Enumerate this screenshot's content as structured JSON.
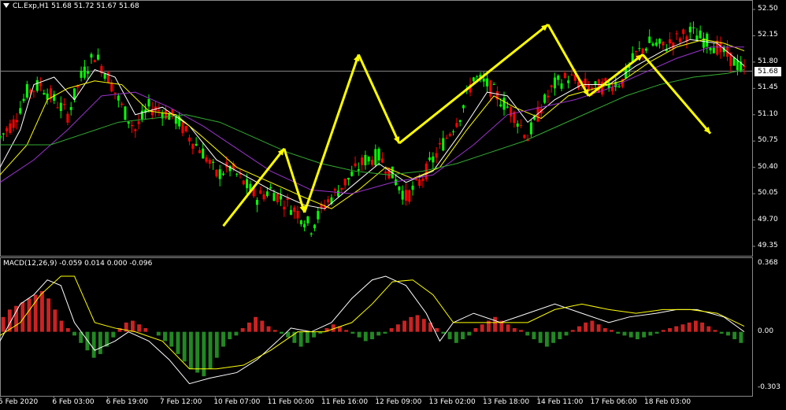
{
  "header": {
    "symbol_line": "CL.Exp,H1  51.68 51.72 51.67 51.68",
    "macd_line": "MACD(12,26,9) -0.059 0.014 0.000 -0.096",
    "current_price": "51.68"
  },
  "chart_data": [
    {
      "type": "candlestick",
      "title": "CL.Exp,H1",
      "ylim": [
        49.35,
        52.5
      ],
      "ytick_labels": [
        "52.50",
        "52.15",
        "51.80",
        "51.45",
        "51.10",
        "50.75",
        "50.40",
        "50.05",
        "49.70",
        "49.35"
      ],
      "xtick_labels": [
        "5 Feb 2020",
        "6 Feb 03:00",
        "6 Feb 19:00",
        "7 Feb 12:00",
        "10 Feb 07:00",
        "11 Feb 00:00",
        "11 Feb 16:00",
        "12 Feb 09:00",
        "13 Feb 02:00",
        "13 Feb 18:00",
        "14 Feb 11:00",
        "17 Feb 06:00",
        "18 Feb 03:00"
      ],
      "current_price": 51.68,
      "price_path": [
        [
          0,
          50.8
        ],
        [
          4,
          51.0
        ],
        [
          8,
          51.4
        ],
        [
          12,
          51.5
        ],
        [
          16,
          51.3
        ],
        [
          20,
          51.1
        ],
        [
          24,
          51.6
        ],
        [
          28,
          51.9
        ],
        [
          32,
          51.6
        ],
        [
          36,
          51.2
        ],
        [
          40,
          50.9
        ],
        [
          44,
          51.2
        ],
        [
          48,
          51.15
        ],
        [
          52,
          51.05
        ],
        [
          56,
          50.8
        ],
        [
          60,
          50.6
        ],
        [
          64,
          50.3
        ],
        [
          68,
          50.4
        ],
        [
          72,
          50.2
        ],
        [
          76,
          50.0
        ],
        [
          80,
          50.1
        ],
        [
          84,
          49.95
        ],
        [
          88,
          49.8
        ],
        [
          92,
          49.6
        ],
        [
          96,
          49.9
        ],
        [
          100,
          50.1
        ],
        [
          104,
          50.3
        ],
        [
          108,
          50.5
        ],
        [
          112,
          50.55
        ],
        [
          116,
          50.3
        ],
        [
          120,
          50.0
        ],
        [
          124,
          50.2
        ],
        [
          128,
          50.5
        ],
        [
          132,
          50.8
        ],
        [
          136,
          51.1
        ],
        [
          140,
          51.6
        ],
        [
          144,
          51.5
        ],
        [
          148,
          51.3
        ],
        [
          152,
          51.1
        ],
        [
          156,
          50.8
        ],
        [
          160,
          51.2
        ],
        [
          164,
          51.5
        ],
        [
          168,
          51.6
        ],
        [
          172,
          51.5
        ],
        [
          176,
          51.45
        ],
        [
          180,
          51.5
        ],
        [
          184,
          51.55
        ],
        [
          188,
          51.9
        ],
        [
          192,
          52.05
        ],
        [
          196,
          52.0
        ],
        [
          200,
          52.1
        ],
        [
          204,
          52.2
        ],
        [
          208,
          52.1
        ],
        [
          212,
          52.0
        ],
        [
          216,
          51.85
        ],
        [
          220,
          51.68
        ]
      ],
      "moving_averages": [
        {
          "color": "#ffffff",
          "points": [
            [
              0,
              50.4
            ],
            [
              6,
              50.9
            ],
            [
              10,
              51.5
            ],
            [
              16,
              51.6
            ],
            [
              22,
              51.3
            ],
            [
              28,
              51.7
            ],
            [
              34,
              51.6
            ],
            [
              40,
              51.1
            ],
            [
              48,
              51.2
            ],
            [
              56,
              50.95
            ],
            [
              64,
              50.5
            ],
            [
              72,
              50.3
            ],
            [
              80,
              50.1
            ],
            [
              90,
              49.9
            ],
            [
              96,
              49.85
            ],
            [
              104,
              50.15
            ],
            [
              112,
              50.45
            ],
            [
              120,
              50.2
            ],
            [
              128,
              50.35
            ],
            [
              136,
              50.85
            ],
            [
              144,
              51.4
            ],
            [
              150,
              51.35
            ],
            [
              156,
              51.0
            ],
            [
              164,
              51.3
            ],
            [
              172,
              51.5
            ],
            [
              180,
              51.5
            ],
            [
              188,
              51.75
            ],
            [
              196,
              51.95
            ],
            [
              204,
              52.1
            ],
            [
              212,
              52.05
            ],
            [
              220,
              51.75
            ]
          ]
        },
        {
          "color": "#ffff00",
          "points": [
            [
              0,
              50.3
            ],
            [
              8,
              50.7
            ],
            [
              14,
              51.3
            ],
            [
              20,
              51.45
            ],
            [
              28,
              51.55
            ],
            [
              36,
              51.5
            ],
            [
              44,
              51.15
            ],
            [
              52,
              51.1
            ],
            [
              60,
              50.8
            ],
            [
              70,
              50.4
            ],
            [
              80,
              50.2
            ],
            [
              90,
              50.0
            ],
            [
              98,
              49.85
            ],
            [
              106,
              50.1
            ],
            [
              114,
              50.4
            ],
            [
              122,
              50.25
            ],
            [
              130,
              50.4
            ],
            [
              138,
              50.9
            ],
            [
              146,
              51.35
            ],
            [
              152,
              51.2
            ],
            [
              160,
              51.05
            ],
            [
              168,
              51.35
            ],
            [
              176,
              51.45
            ],
            [
              184,
              51.55
            ],
            [
              192,
              51.8
            ],
            [
              200,
              52.0
            ],
            [
              208,
              52.1
            ],
            [
              214,
              52.05
            ],
            [
              220,
              51.95
            ]
          ]
        },
        {
          "color": "#9933cc",
          "points": [
            [
              0,
              50.2
            ],
            [
              10,
              50.5
            ],
            [
              20,
              50.9
            ],
            [
              30,
              51.35
            ],
            [
              40,
              51.4
            ],
            [
              50,
              51.2
            ],
            [
              60,
              50.95
            ],
            [
              70,
              50.65
            ],
            [
              80,
              50.35
            ],
            [
              92,
              50.1
            ],
            [
              104,
              50.05
            ],
            [
              116,
              50.2
            ],
            [
              128,
              50.3
            ],
            [
              140,
              50.7
            ],
            [
              150,
              51.1
            ],
            [
              160,
              51.2
            ],
            [
              170,
              51.3
            ],
            [
              180,
              51.45
            ],
            [
              190,
              51.65
            ],
            [
              200,
              51.85
            ],
            [
              210,
              52.0
            ],
            [
              220,
              52.0
            ]
          ]
        },
        {
          "color": "#33aa33",
          "points": [
            [
              0,
              50.7
            ],
            [
              15,
              50.7
            ],
            [
              25,
              50.85
            ],
            [
              35,
              51.0
            ],
            [
              45,
              51.05
            ],
            [
              55,
              51.1
            ],
            [
              65,
              51.0
            ],
            [
              75,
              50.8
            ],
            [
              85,
              50.6
            ],
            [
              95,
              50.45
            ],
            [
              105,
              50.35
            ],
            [
              115,
              50.3
            ],
            [
              125,
              50.35
            ],
            [
              135,
              50.45
            ],
            [
              145,
              50.6
            ],
            [
              155,
              50.75
            ],
            [
              165,
              50.95
            ],
            [
              175,
              51.15
            ],
            [
              185,
              51.35
            ],
            [
              195,
              51.5
            ],
            [
              205,
              51.6
            ],
            [
              215,
              51.65
            ],
            [
              220,
              51.7
            ]
          ]
        }
      ],
      "wave_projection": [
        [
          66,
          49.62
        ],
        [
          84,
          50.65
        ],
        [
          90,
          49.8
        ],
        [
          106,
          51.9
        ],
        [
          118,
          50.72
        ],
        [
          162,
          52.3
        ],
        [
          174,
          51.35
        ],
        [
          190,
          51.9
        ],
        [
          210,
          50.85
        ]
      ]
    },
    {
      "type": "histogram+line",
      "title": "MACD(12,26,9)",
      "ylim": [
        -0.303,
        0.368
      ],
      "ytick_labels": [
        "0.368",
        "0.00",
        "-0.303"
      ],
      "macd_line": [
        [
          0,
          -0.05
        ],
        [
          6,
          0.15
        ],
        [
          10,
          0.2
        ],
        [
          14,
          0.28
        ],
        [
          18,
          0.25
        ],
        [
          22,
          0.05
        ],
        [
          28,
          -0.1
        ],
        [
          34,
          -0.05
        ],
        [
          38,
          0.0
        ],
        [
          44,
          -0.05
        ],
        [
          50,
          -0.15
        ],
        [
          56,
          -0.28
        ],
        [
          62,
          -0.25
        ],
        [
          70,
          -0.22
        ],
        [
          76,
          -0.15
        ],
        [
          82,
          -0.05
        ],
        [
          86,
          0.02
        ],
        [
          92,
          0.0
        ],
        [
          98,
          0.05
        ],
        [
          104,
          0.18
        ],
        [
          110,
          0.28
        ],
        [
          114,
          0.3
        ],
        [
          120,
          0.25
        ],
        [
          126,
          0.1
        ],
        [
          130,
          -0.05
        ],
        [
          134,
          0.05
        ],
        [
          140,
          0.1
        ],
        [
          148,
          0.05
        ],
        [
          156,
          0.1
        ],
        [
          164,
          0.15
        ],
        [
          172,
          0.1
        ],
        [
          180,
          0.05
        ],
        [
          186,
          0.08
        ],
        [
          194,
          0.1
        ],
        [
          200,
          0.12
        ],
        [
          206,
          0.12
        ],
        [
          214,
          0.08
        ],
        [
          220,
          0.0
        ]
      ],
      "signal_line": [
        [
          0,
          -0.02
        ],
        [
          6,
          0.05
        ],
        [
          12,
          0.2
        ],
        [
          18,
          0.3
        ],
        [
          22,
          0.3
        ],
        [
          28,
          0.05
        ],
        [
          34,
          0.02
        ],
        [
          40,
          0.0
        ],
        [
          48,
          -0.05
        ],
        [
          56,
          -0.2
        ],
        [
          64,
          -0.2
        ],
        [
          72,
          -0.18
        ],
        [
          80,
          -0.1
        ],
        [
          88,
          0.0
        ],
        [
          96,
          0.0
        ],
        [
          104,
          0.05
        ],
        [
          110,
          0.15
        ],
        [
          116,
          0.27
        ],
        [
          122,
          0.28
        ],
        [
          128,
          0.2
        ],
        [
          134,
          0.05
        ],
        [
          140,
          0.05
        ],
        [
          148,
          0.05
        ],
        [
          156,
          0.05
        ],
        [
          164,
          0.12
        ],
        [
          172,
          0.15
        ],
        [
          180,
          0.12
        ],
        [
          188,
          0.1
        ],
        [
          196,
          0.12
        ],
        [
          204,
          0.12
        ],
        [
          212,
          0.1
        ],
        [
          220,
          0.03
        ]
      ],
      "histogram": [
        0.08,
        0.12,
        0.14,
        0.16,
        0.18,
        0.2,
        0.22,
        0.18,
        0.12,
        0.06,
        0.02,
        -0.02,
        -0.06,
        -0.1,
        -0.14,
        -0.12,
        -0.08,
        -0.03,
        0.02,
        0.05,
        0.06,
        0.04,
        0.02,
        0.0,
        -0.02,
        -0.05,
        -0.08,
        -0.12,
        -0.16,
        -0.2,
        -0.22,
        -0.24,
        -0.2,
        -0.14,
        -0.08,
        -0.04,
        -0.02,
        0.02,
        0.05,
        0.08,
        0.06,
        0.03,
        0.01,
        -0.01,
        -0.03,
        -0.06,
        -0.08,
        -0.06,
        -0.03,
        -0.01,
        0.02,
        0.04,
        0.03,
        0.01,
        -0.01,
        -0.03,
        -0.05,
        -0.04,
        -0.02,
        -0.01,
        0.02,
        0.04,
        0.06,
        0.08,
        0.09,
        0.07,
        0.05,
        0.02,
        -0.01,
        -0.04,
        -0.06,
        -0.04,
        -0.02,
        0.02,
        0.04,
        0.06,
        0.08,
        0.06,
        0.04,
        0.02,
        0.01,
        -0.02,
        -0.04,
        -0.06,
        -0.08,
        -0.06,
        -0.04,
        -0.02,
        0.01,
        0.03,
        0.05,
        0.06,
        0.04,
        0.02,
        0.01,
        -0.01,
        -0.02,
        -0.03,
        -0.04,
        -0.03,
        -0.02,
        -0.01,
        0.01,
        0.02,
        0.03,
        0.04,
        0.05,
        0.06,
        0.05,
        0.03,
        0.01,
        -0.01,
        -0.02,
        -0.04,
        -0.06
      ]
    }
  ]
}
